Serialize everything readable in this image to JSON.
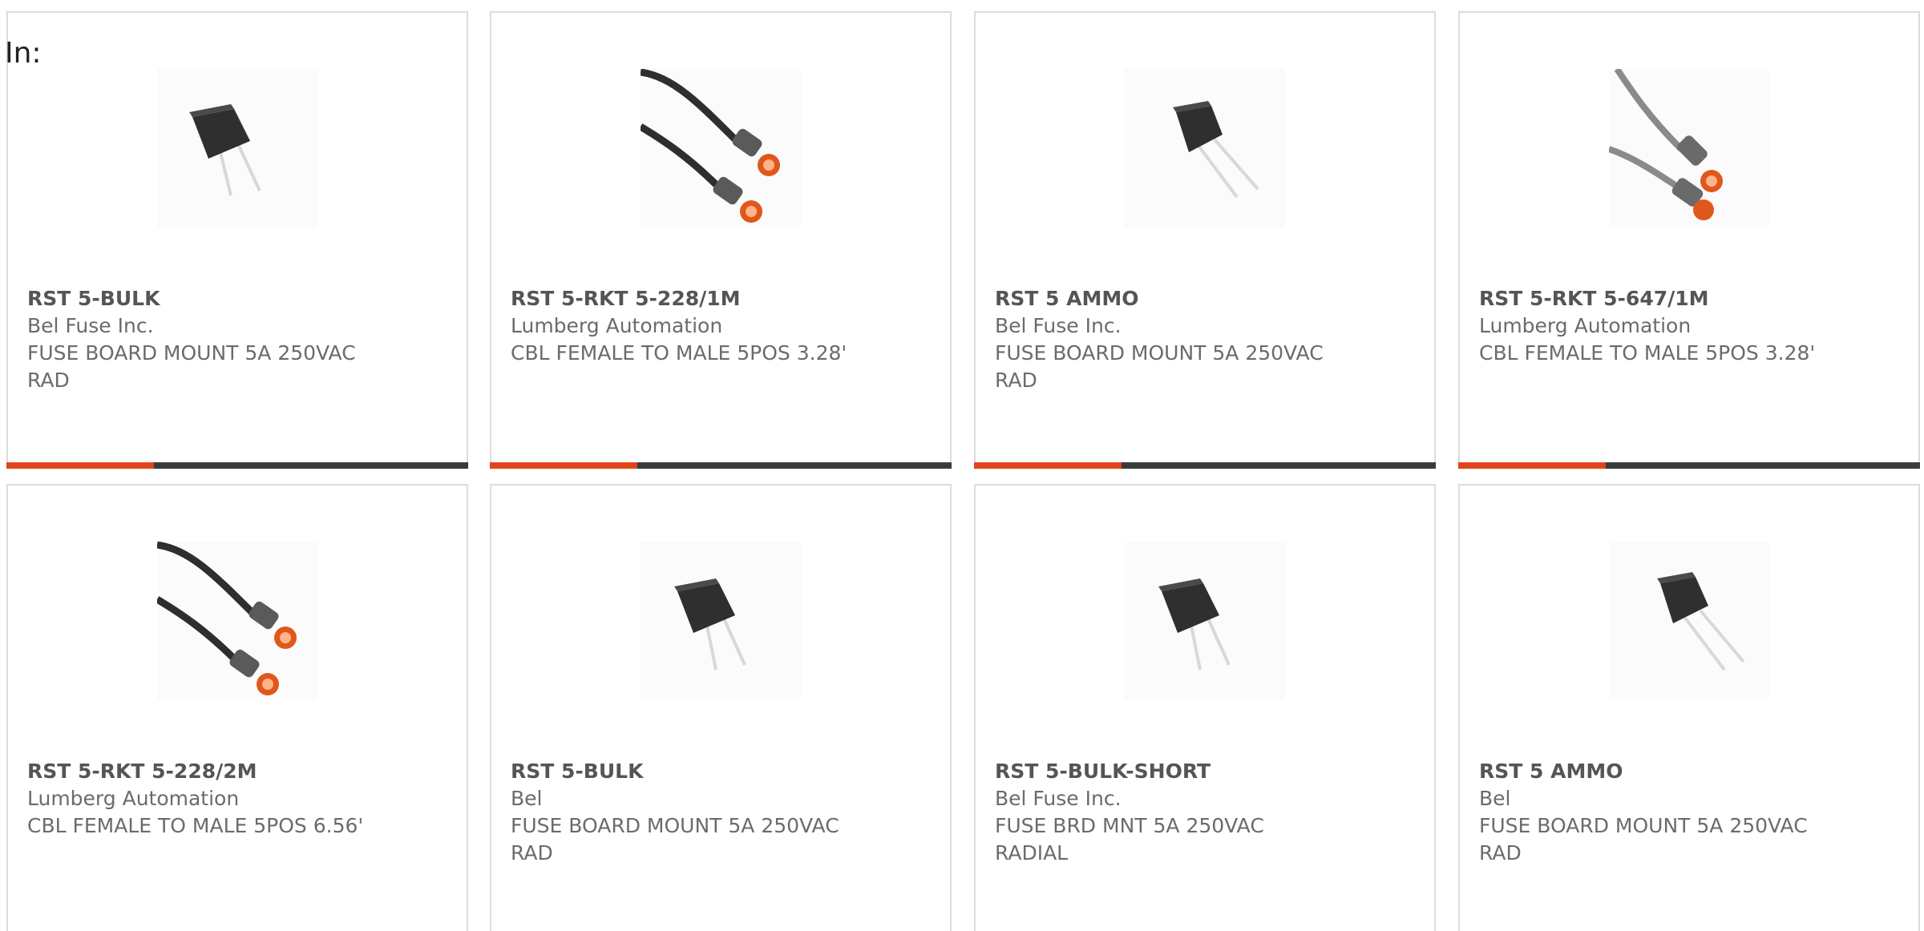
{
  "header": {
    "in_label": "In:"
  },
  "accent_color": "#e0451a",
  "bar_color": "#3a3a3a",
  "products": [
    {
      "part": "RST 5-BULK",
      "manufacturer": "Bel Fuse Inc.",
      "description": "FUSE BOARD MOUNT 5A 250VAC RAD",
      "image": "radial-fuse-image",
      "bar_fill_fraction": 0.32
    },
    {
      "part": "RST 5-RKT 5-228/1M",
      "manufacturer": "Lumberg Automation",
      "description": "CBL FEMALE TO MALE 5POS 3.28'",
      "image": "sensor-cable-dark-image",
      "bar_fill_fraction": 0.32
    },
    {
      "part": "RST 5 AMMO",
      "manufacturer": "Bel Fuse Inc.",
      "description": "FUSE BOARD MOUNT 5A 250VAC RAD",
      "image": "radial-fuse-image",
      "bar_fill_fraction": 0.32
    },
    {
      "part": "RST 5-RKT 5-647/1M",
      "manufacturer": "Lumberg Automation",
      "description": "CBL FEMALE TO MALE 5POS 3.28'",
      "image": "sensor-cable-gray-image",
      "bar_fill_fraction": 0.32
    },
    {
      "part": "RST 5-RKT 5-228/2M",
      "manufacturer": "Lumberg Automation",
      "description": "CBL FEMALE TO MALE 5POS 6.56'",
      "image": "sensor-cable-dark-image"
    },
    {
      "part": "RST 5-BULK",
      "manufacturer": "Bel",
      "description": "FUSE BOARD MOUNT 5A 250VAC RAD",
      "image": "radial-fuse-image"
    },
    {
      "part": "RST 5-BULK-SHORT",
      "manufacturer": "Bel Fuse Inc.",
      "description": "FUSE BRD MNT 5A 250VAC RADIAL",
      "image": "radial-fuse-image"
    },
    {
      "part": "RST 5 AMMO",
      "manufacturer": "Bel",
      "description": "FUSE BOARD MOUNT 5A 250VAC RAD",
      "image": "radial-fuse-image"
    }
  ]
}
